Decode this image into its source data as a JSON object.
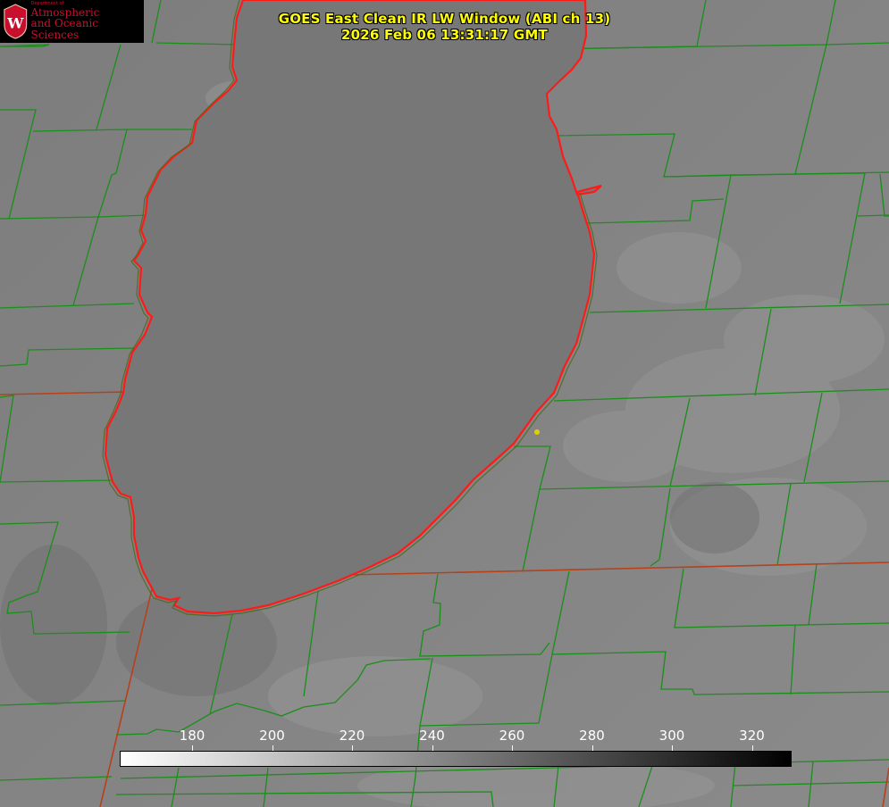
{
  "title": {
    "line1": "GOES East Clean IR LW Window (ABI ch 13)",
    "line2": "2026 Feb 06 13:31:17 GMT"
  },
  "logo": {
    "dept": "Department of",
    "line1": "Atmospheric",
    "line2": "and Oceanic Sciences",
    "crest": "W"
  },
  "colorbar": {
    "ticks": [
      "180",
      "200",
      "220",
      "240",
      "260",
      "280",
      "300",
      "320"
    ],
    "gradient_start": "#ffffff",
    "gradient_end": "#000000"
  },
  "colors": {
    "county_lines": "#1a8f1a",
    "lake_outline": "#ff1a1a",
    "state_lines": "#b8401a",
    "marker": "#e0d000",
    "lake_fill": "#777777"
  }
}
